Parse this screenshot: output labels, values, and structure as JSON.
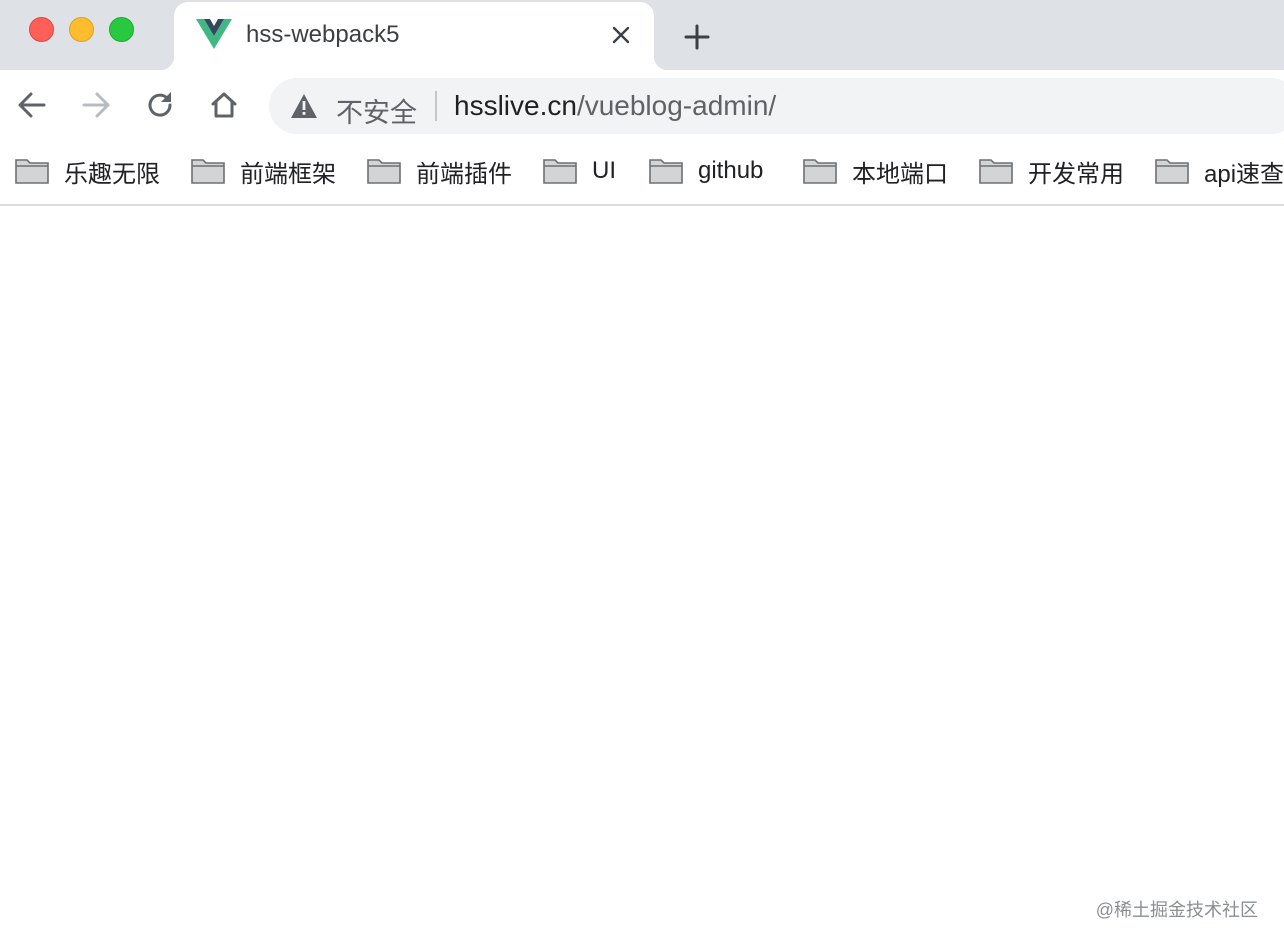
{
  "window": {
    "controls": [
      "close",
      "minimize",
      "maximize"
    ],
    "colors": {
      "close": "#fe5f57",
      "minimize": "#febc2e",
      "maximize": "#28c840"
    }
  },
  "tab": {
    "title": "hss-webpack5",
    "favicon": "vue-logo-icon"
  },
  "toolbar": {
    "security_label": "不安全",
    "url_host": "hsslive.cn",
    "url_path": "/vueblog-admin/"
  },
  "bookmarks": [
    {
      "label": "乐趣无限"
    },
    {
      "label": "前端框架"
    },
    {
      "label": "前端插件"
    },
    {
      "label": "UI"
    },
    {
      "label": "github"
    },
    {
      "label": "本地端口"
    },
    {
      "label": "开发常用"
    },
    {
      "label": "api速查"
    }
  ],
  "watermark": "@稀土掘金技术社区"
}
